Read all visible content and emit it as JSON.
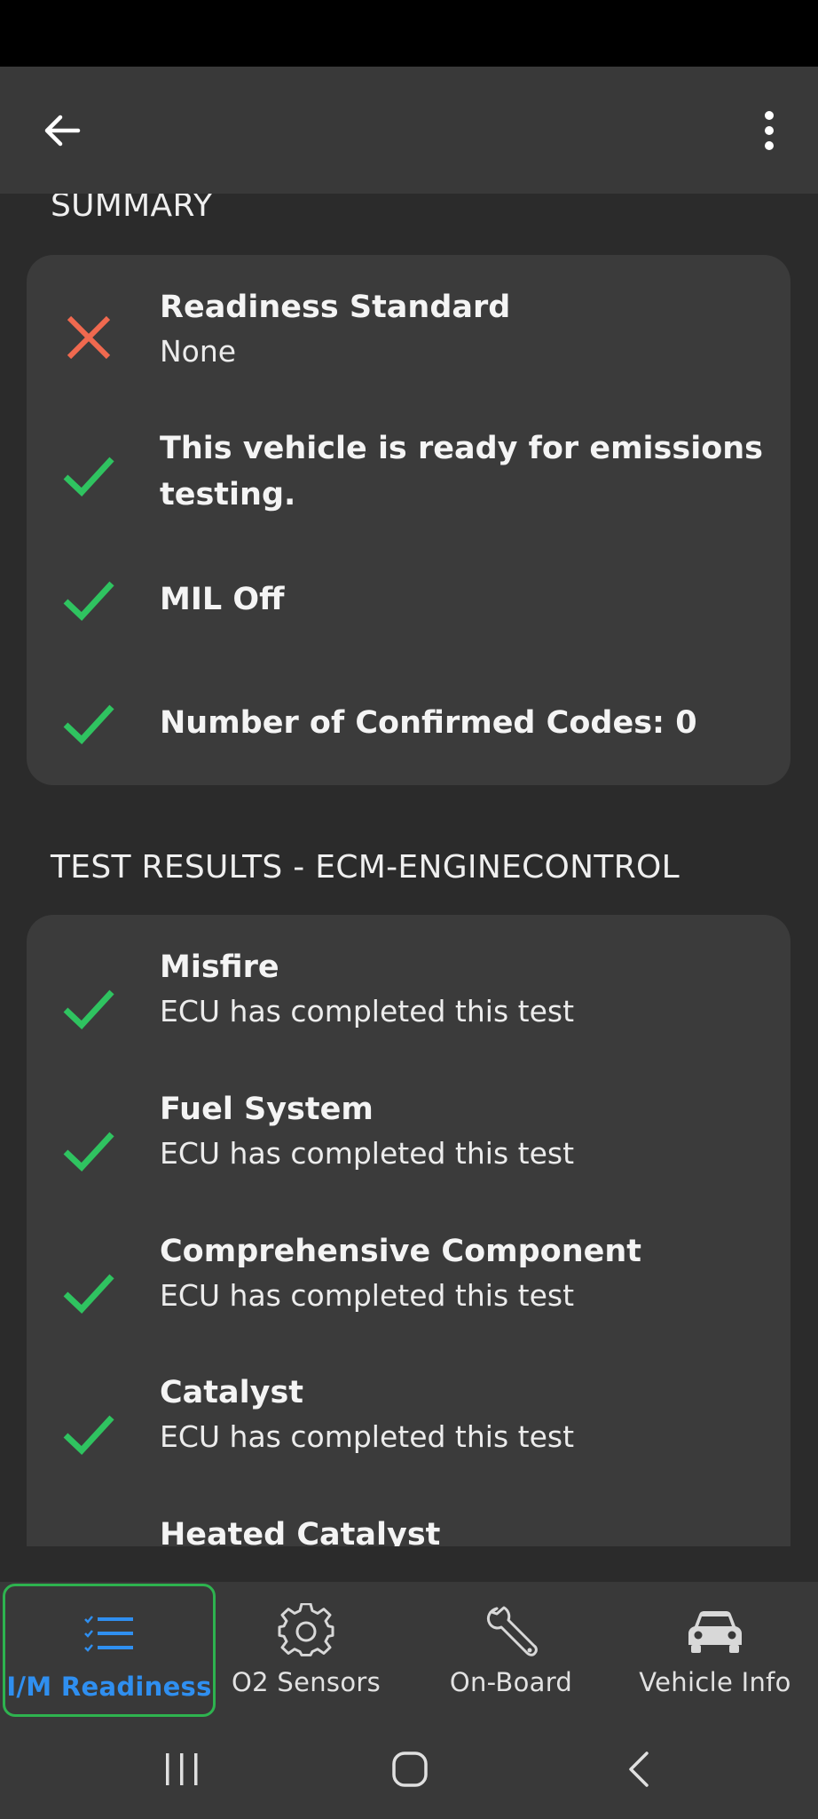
{
  "summary": {
    "section_title": "SUMMARY",
    "items": [
      {
        "title": "Readiness Standard",
        "subtitle": "None",
        "status": "fail"
      },
      {
        "title": "This vehicle is ready for emissions testing.",
        "status": "pass"
      },
      {
        "title": "MIL Off",
        "status": "pass"
      },
      {
        "title": "Number of Confirmed Codes: 0",
        "status": "pass"
      }
    ]
  },
  "test_results": {
    "section_title": "TEST RESULTS - ECM-ENGINECONTROL",
    "items": [
      {
        "title": "Misfire",
        "subtitle": "ECU has completed this test",
        "status": "pass"
      },
      {
        "title": "Fuel System",
        "subtitle": "ECU has completed this test",
        "status": "pass"
      },
      {
        "title": "Comprehensive Component",
        "subtitle": "ECU has completed this test",
        "status": "pass"
      },
      {
        "title": "Catalyst",
        "subtitle": "ECU has completed this test",
        "status": "pass"
      },
      {
        "title": "Heated Catalyst",
        "status": "pass"
      }
    ]
  },
  "bottom_nav": {
    "items": [
      {
        "label": "I/M Readiness",
        "icon": "checklist-icon",
        "active": true
      },
      {
        "label": "O2 Sensors",
        "icon": "gear-icon",
        "active": false
      },
      {
        "label": "On-Board",
        "icon": "wrench-icon",
        "active": false
      },
      {
        "label": "Vehicle Info",
        "icon": "car-icon",
        "active": false
      }
    ]
  },
  "colors": {
    "pass": "#2fc360",
    "fail": "#f0694f",
    "active_nav_border": "#2eb34f",
    "active_nav_text": "#2f8ff0",
    "card_bg": "#3b3b3b",
    "app_bar_bg": "#393939"
  }
}
